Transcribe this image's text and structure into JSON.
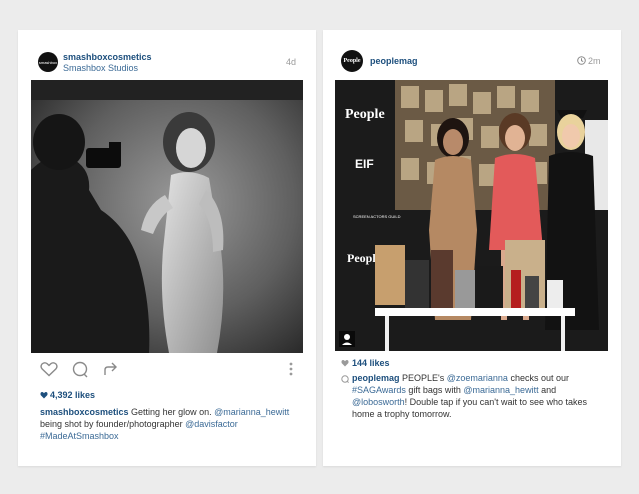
{
  "post1": {
    "username": "smashboxcosmetics",
    "location": "Smashbox Studios",
    "time_ago": "4d",
    "avatar_text": "smashbox",
    "likes": "4,392 likes",
    "caption": {
      "username": "smashboxcosmetics",
      "text_1": " Getting her glow on. ",
      "mention_1": "@marianna_hewitt",
      "text_2": "being shot by founder/photographer ",
      "mention_2": "@davisfactor",
      "hashtag_1": "#MadeAtSmashbox"
    },
    "icons": [
      "heart-icon",
      "comment-icon",
      "share-icon",
      "more-options-icon"
    ]
  },
  "post2": {
    "username": "peoplemag",
    "avatar_text": "People",
    "time_ago": "2m",
    "photo_texts": {
      "brand_1": "People",
      "brand_2": "People",
      "eif": "EIF",
      "sag": "SCREEN ACTORS GUILD"
    },
    "likes": "144 likes",
    "caption": {
      "username": "peoplemag",
      "text_1": " PEOPLE's ",
      "mention_1": "@zoemarianna",
      "text_2": " checks out our ",
      "hashtag_1": "#SAGAwards",
      "text_3": " gift bags with ",
      "mention_2": "@marianna_hewitt",
      "text_4": " and ",
      "mention_3": "@lobosworth",
      "text_5": "! Double tap if you can't wait to see who takes home a trophy tomorrow."
    },
    "icons": [
      "clock-icon",
      "heart-icon",
      "comment-icon",
      "user-tag-icon"
    ]
  }
}
